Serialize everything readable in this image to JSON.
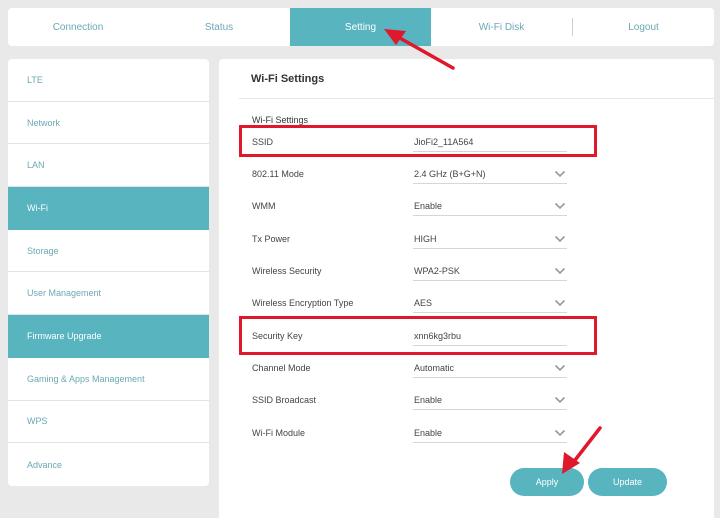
{
  "topnav": {
    "tabs": [
      {
        "label": "Connection"
      },
      {
        "label": "Status"
      },
      {
        "label": "Setting",
        "active": true
      },
      {
        "label": "Wi-Fi Disk"
      },
      {
        "label": "Logout"
      }
    ]
  },
  "sidebar": {
    "items": [
      {
        "label": "LTE"
      },
      {
        "label": "Network"
      },
      {
        "label": "LAN"
      },
      {
        "label": "Wi-Fi",
        "active": true
      },
      {
        "label": "Storage"
      },
      {
        "label": "User Management"
      },
      {
        "label": "Firmware Upgrade",
        "active": true
      },
      {
        "label": "Gaming & Apps Management"
      },
      {
        "label": "WPS"
      },
      {
        "label": "Advance"
      }
    ]
  },
  "panel": {
    "title": "Wi-Fi Settings",
    "section_title": "Wi-Fi Settings",
    "fields": [
      {
        "label": "SSID",
        "value": "JioFi2_11A564"
      },
      {
        "label": "802.11 Mode",
        "value": "2.4 GHz (B+G+N)",
        "dropdown": true
      },
      {
        "label": "WMM",
        "value": "Enable",
        "dropdown": true
      },
      {
        "label": "Tx Power",
        "value": "HIGH",
        "dropdown": true
      },
      {
        "label": "Wireless Security",
        "value": "WPA2-PSK",
        "dropdown": true
      },
      {
        "label": "Wireless Encryption Type",
        "value": "AES",
        "dropdown": true
      },
      {
        "label": "Security Key",
        "value": "xnn6kg3rbu"
      },
      {
        "label": "Channel Mode",
        "value": "Automatic",
        "dropdown": true
      },
      {
        "label": "SSID Broadcast",
        "value": "Enable",
        "dropdown": true
      },
      {
        "label": "Wi-Fi Module",
        "value": "Enable",
        "dropdown": true
      }
    ],
    "buttons": {
      "apply": "Apply",
      "update": "Update"
    }
  },
  "colors": {
    "accent": "#58b4bf",
    "link": "#6aa9b4",
    "annotation": "#e0182c"
  },
  "icons": {
    "dropdown": "chevron-down-icon",
    "annotation": "red-arrow-icon"
  }
}
